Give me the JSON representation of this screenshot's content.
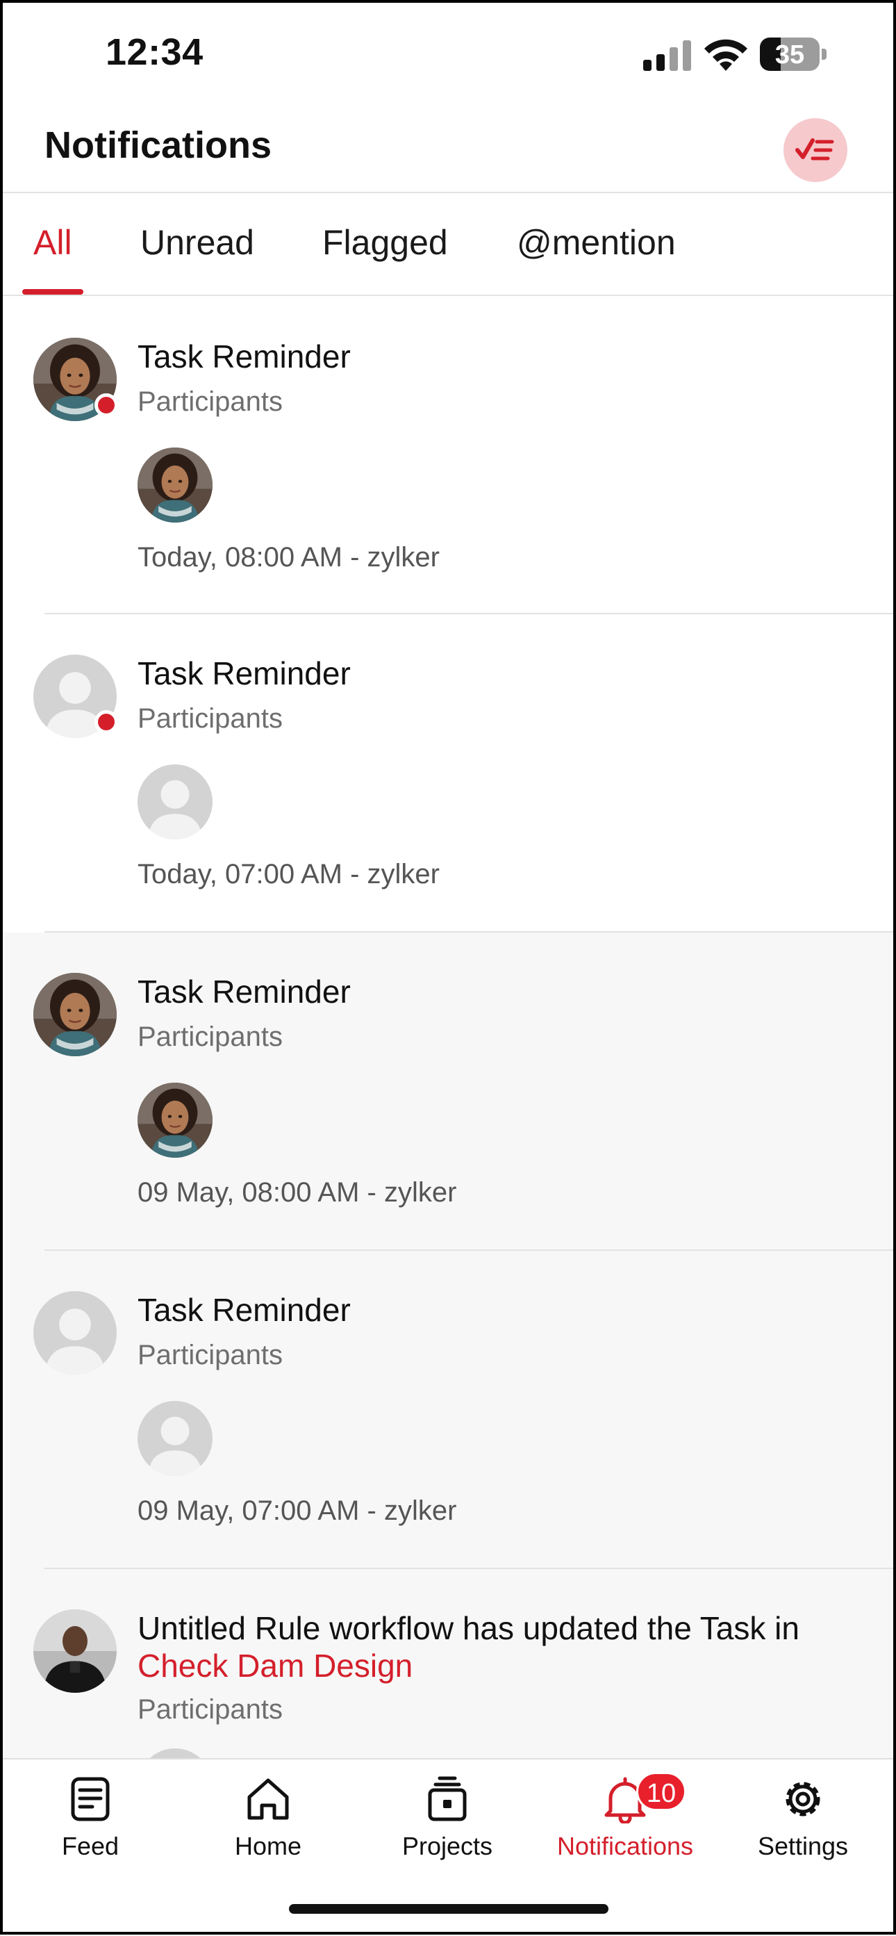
{
  "status_bar": {
    "time": "12:34",
    "battery": "35",
    "battery_fraction": 0.35
  },
  "header": {
    "title": "Notifications",
    "mark_all_read_icon": "checklist-icon",
    "accent": "#d41f2b"
  },
  "tabs": [
    {
      "label": "All",
      "active": true
    },
    {
      "label": "Unread",
      "active": false
    },
    {
      "label": "Flagged",
      "active": false
    },
    {
      "label": "@mention",
      "active": false
    }
  ],
  "notifications": [
    {
      "title": "Task Reminder",
      "subtitle": "Participants",
      "meta": "Today, 08:00 AM - zylker",
      "unread": true,
      "avatar": "woman-photo"
    },
    {
      "title": "Task Reminder",
      "subtitle": "Participants",
      "meta": "Today, 07:00 AM - zylker",
      "unread": true,
      "avatar": "default-user"
    },
    {
      "title": "Task Reminder",
      "subtitle": "Participants",
      "meta": "09 May, 08:00 AM - zylker",
      "unread": false,
      "avatar": "woman-photo"
    },
    {
      "title": "Task Reminder",
      "subtitle": "Participants",
      "meta": "09 May, 07:00 AM - zylker",
      "unread": false,
      "avatar": "default-user"
    },
    {
      "title_prefix": "Untitled Rule workflow has updated the Task in",
      "title_link": "Check Dam Design",
      "subtitle": "Participants",
      "unread": false,
      "avatar": "man-photo"
    }
  ],
  "bottom_nav": [
    {
      "label": "Feed",
      "icon": "feed-icon",
      "active": false
    },
    {
      "label": "Home",
      "icon": "home-icon",
      "active": false
    },
    {
      "label": "Projects",
      "icon": "projects-icon",
      "active": false
    },
    {
      "label": "Notifications",
      "icon": "bell-icon",
      "active": true,
      "badge": "10"
    },
    {
      "label": "Settings",
      "icon": "gear-icon",
      "active": false
    }
  ]
}
